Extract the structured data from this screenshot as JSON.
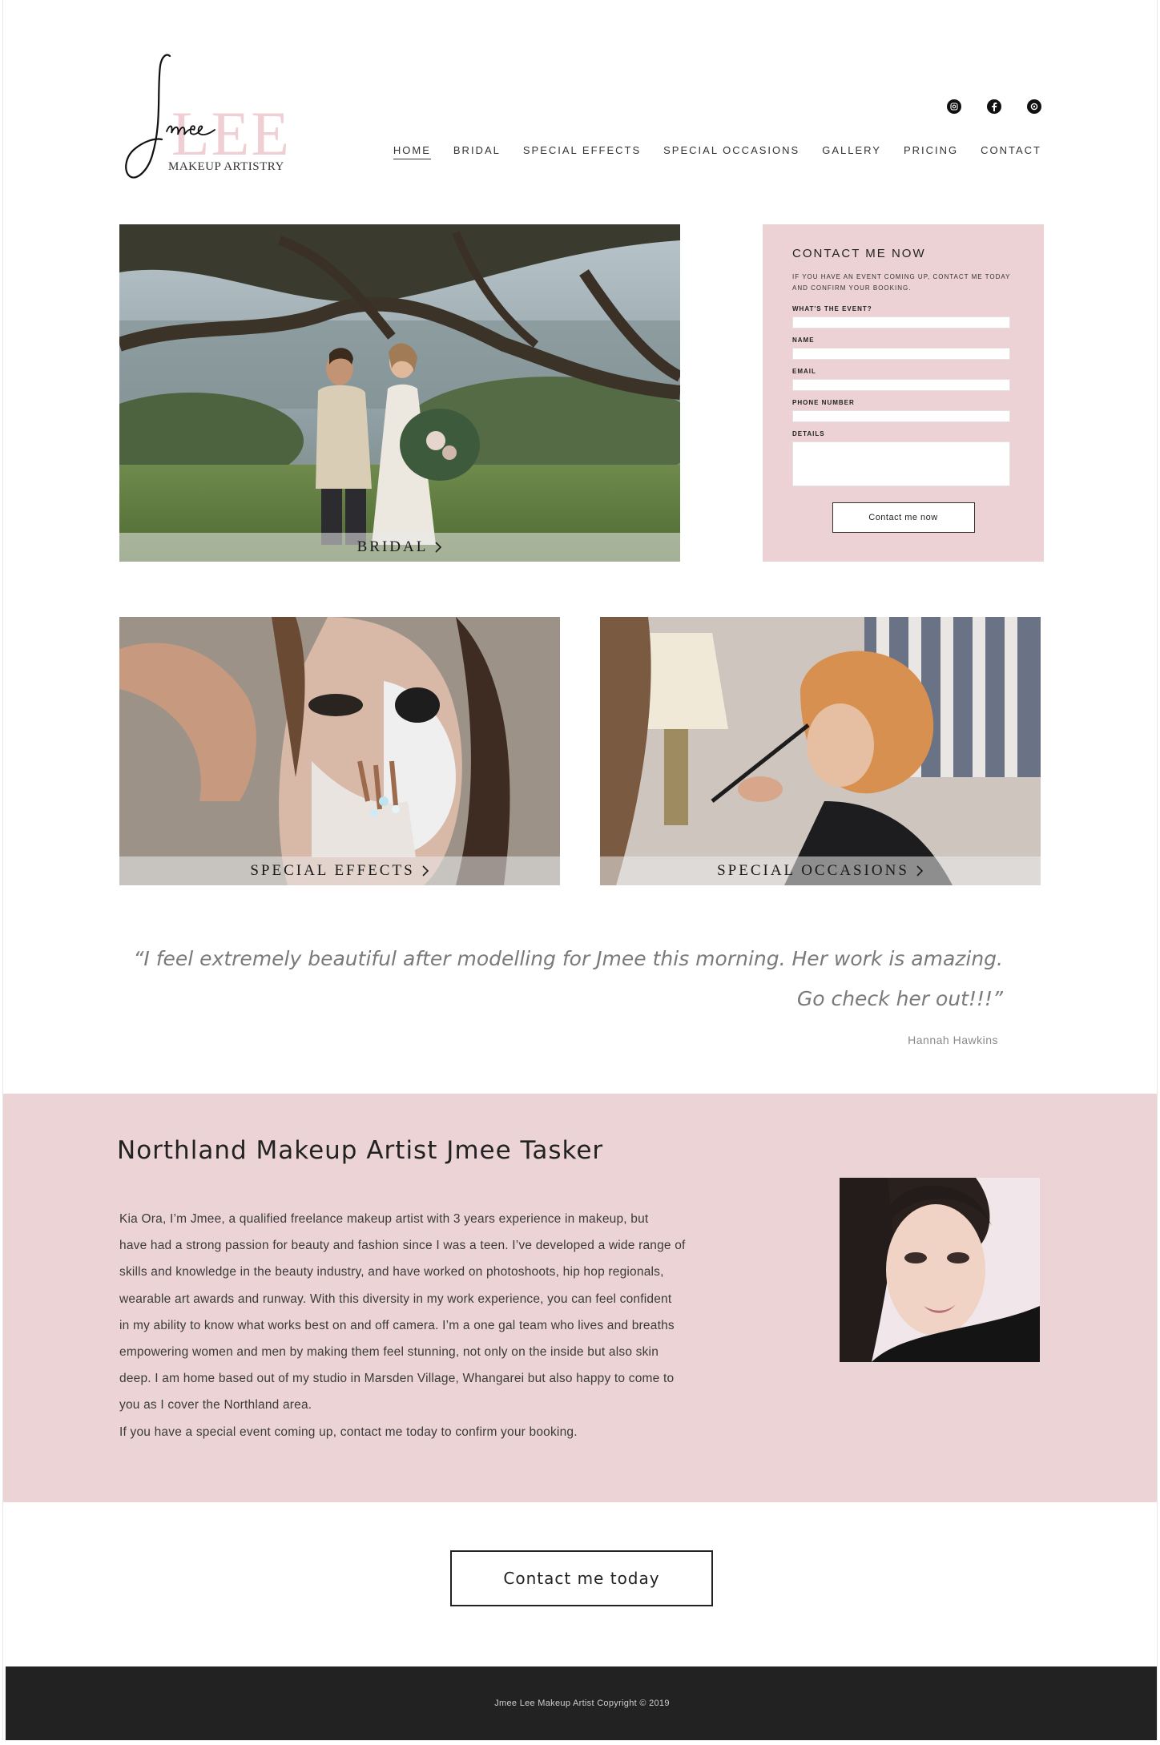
{
  "brand": {
    "script_name": "Jmee",
    "block_name": "LEE",
    "tagline": "MAKEUP ARTISTRY"
  },
  "social": [
    {
      "icon": "instagram-icon"
    },
    {
      "icon": "facebook-icon"
    },
    {
      "icon": "pinterest-icon"
    }
  ],
  "nav": {
    "items": [
      "HOME",
      "BRIDAL",
      "SPECIAL EFFECTS",
      "SPECIAL OCCASIONS",
      "GALLERY",
      "PRICING",
      "CONTACT"
    ],
    "active": "HOME"
  },
  "tiles": {
    "bridal": "BRIDAL",
    "special_effects": "SPECIAL EFFECTS",
    "special_occasions": "SPECIAL OCCASIONS"
  },
  "contact_form": {
    "title": "CONTACT ME NOW",
    "intro": "IF YOU HAVE AN EVENT COMING UP, CONTACT ME TODAY AND CONFIRM YOUR BOOKING.",
    "fields": [
      "WHAT'S THE EVENT?",
      "NAME",
      "EMAIL",
      "PHONE NUMBER",
      "DETAILS"
    ],
    "submit_label": "Contact me now"
  },
  "testimonial": {
    "line1": "“I feel extremely beautiful after modelling for Jmee this morning. Her work is amazing.",
    "line2": "Go check her out!!!”",
    "author": "Hannah Hawkins"
  },
  "about": {
    "heading": "Northland Makeup Artist Jmee Tasker",
    "lines": [
      "Kia Ora,  I’m Jmee, a qualified freelance makeup artist with 3 years experience in makeup, but",
      "have had a strong passion for beauty and fashion since I was a teen. I’ve developed a wide range of",
      "skills and knowledge in the beauty industry, and have worked on photoshoots, hip hop regionals,",
      "wearable art awards and runway. With this diversity in my work experience, you can feel confident",
      "in my ability to know what works best on and off camera. I’m a one gal team who lives and breaths",
      "empowering women and men by making them feel stunning, not only on the inside but also skin",
      "deep. I am home based out of my studio in Marsden Village, Whangarei but also happy to come to",
      "you as I cover the Northland area.",
      "If you have a special event coming up, contact me today to confirm your booking."
    ]
  },
  "cta": {
    "label": "Contact me today"
  },
  "footer": {
    "copyright": "Jmee Lee Makeup Artist Copyright © 2019"
  },
  "colors": {
    "accent_pink": "#ecd4d6",
    "footer_bg": "#222222"
  }
}
